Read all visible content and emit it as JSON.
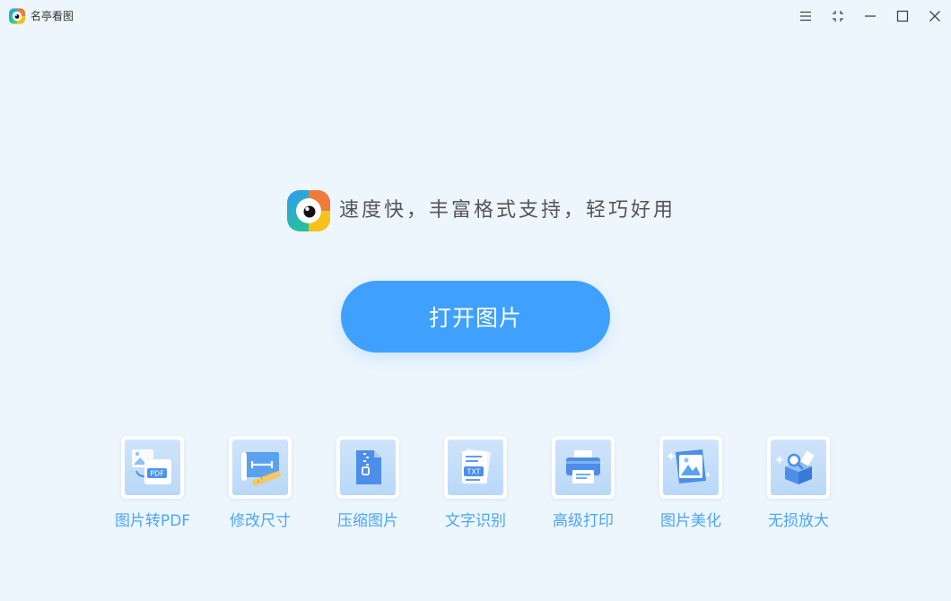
{
  "app": {
    "title": "名亭看图",
    "slogan": "速度快，丰富格式支持，轻巧好用"
  },
  "window_controls": [
    {
      "name": "menu-button",
      "icon": "hamburger-menu-icon"
    },
    {
      "name": "fullscreen-button",
      "icon": "fullscreen-icon"
    },
    {
      "name": "minimize-button",
      "icon": "minimize-icon"
    },
    {
      "name": "maximize-button",
      "icon": "maximize-icon"
    },
    {
      "name": "close-button",
      "icon": "close-icon"
    }
  ],
  "main": {
    "open_button_label": "打开图片"
  },
  "tools": [
    {
      "label": "图片转PDF",
      "icon": "image-to-pdf-icon"
    },
    {
      "label": "修改尺寸",
      "icon": "resize-ruler-icon"
    },
    {
      "label": "压缩图片",
      "icon": "zip-compress-icon"
    },
    {
      "label": "文字识别",
      "icon": "txt-ocr-icon"
    },
    {
      "label": "高级打印",
      "icon": "printer-icon"
    },
    {
      "label": "图片美化",
      "icon": "beautify-image-icon"
    },
    {
      "label": "无损放大",
      "icon": "lossless-enlarge-icon"
    }
  ],
  "colors": {
    "background": "#edf5fd",
    "accent": "#3fa1fd",
    "tool_label": "#4ba7f5",
    "logo_green": "#27c68c",
    "logo_blue": "#2e9bf5",
    "logo_orange": "#f07a3a",
    "logo_yellow": "#f6c21a"
  }
}
